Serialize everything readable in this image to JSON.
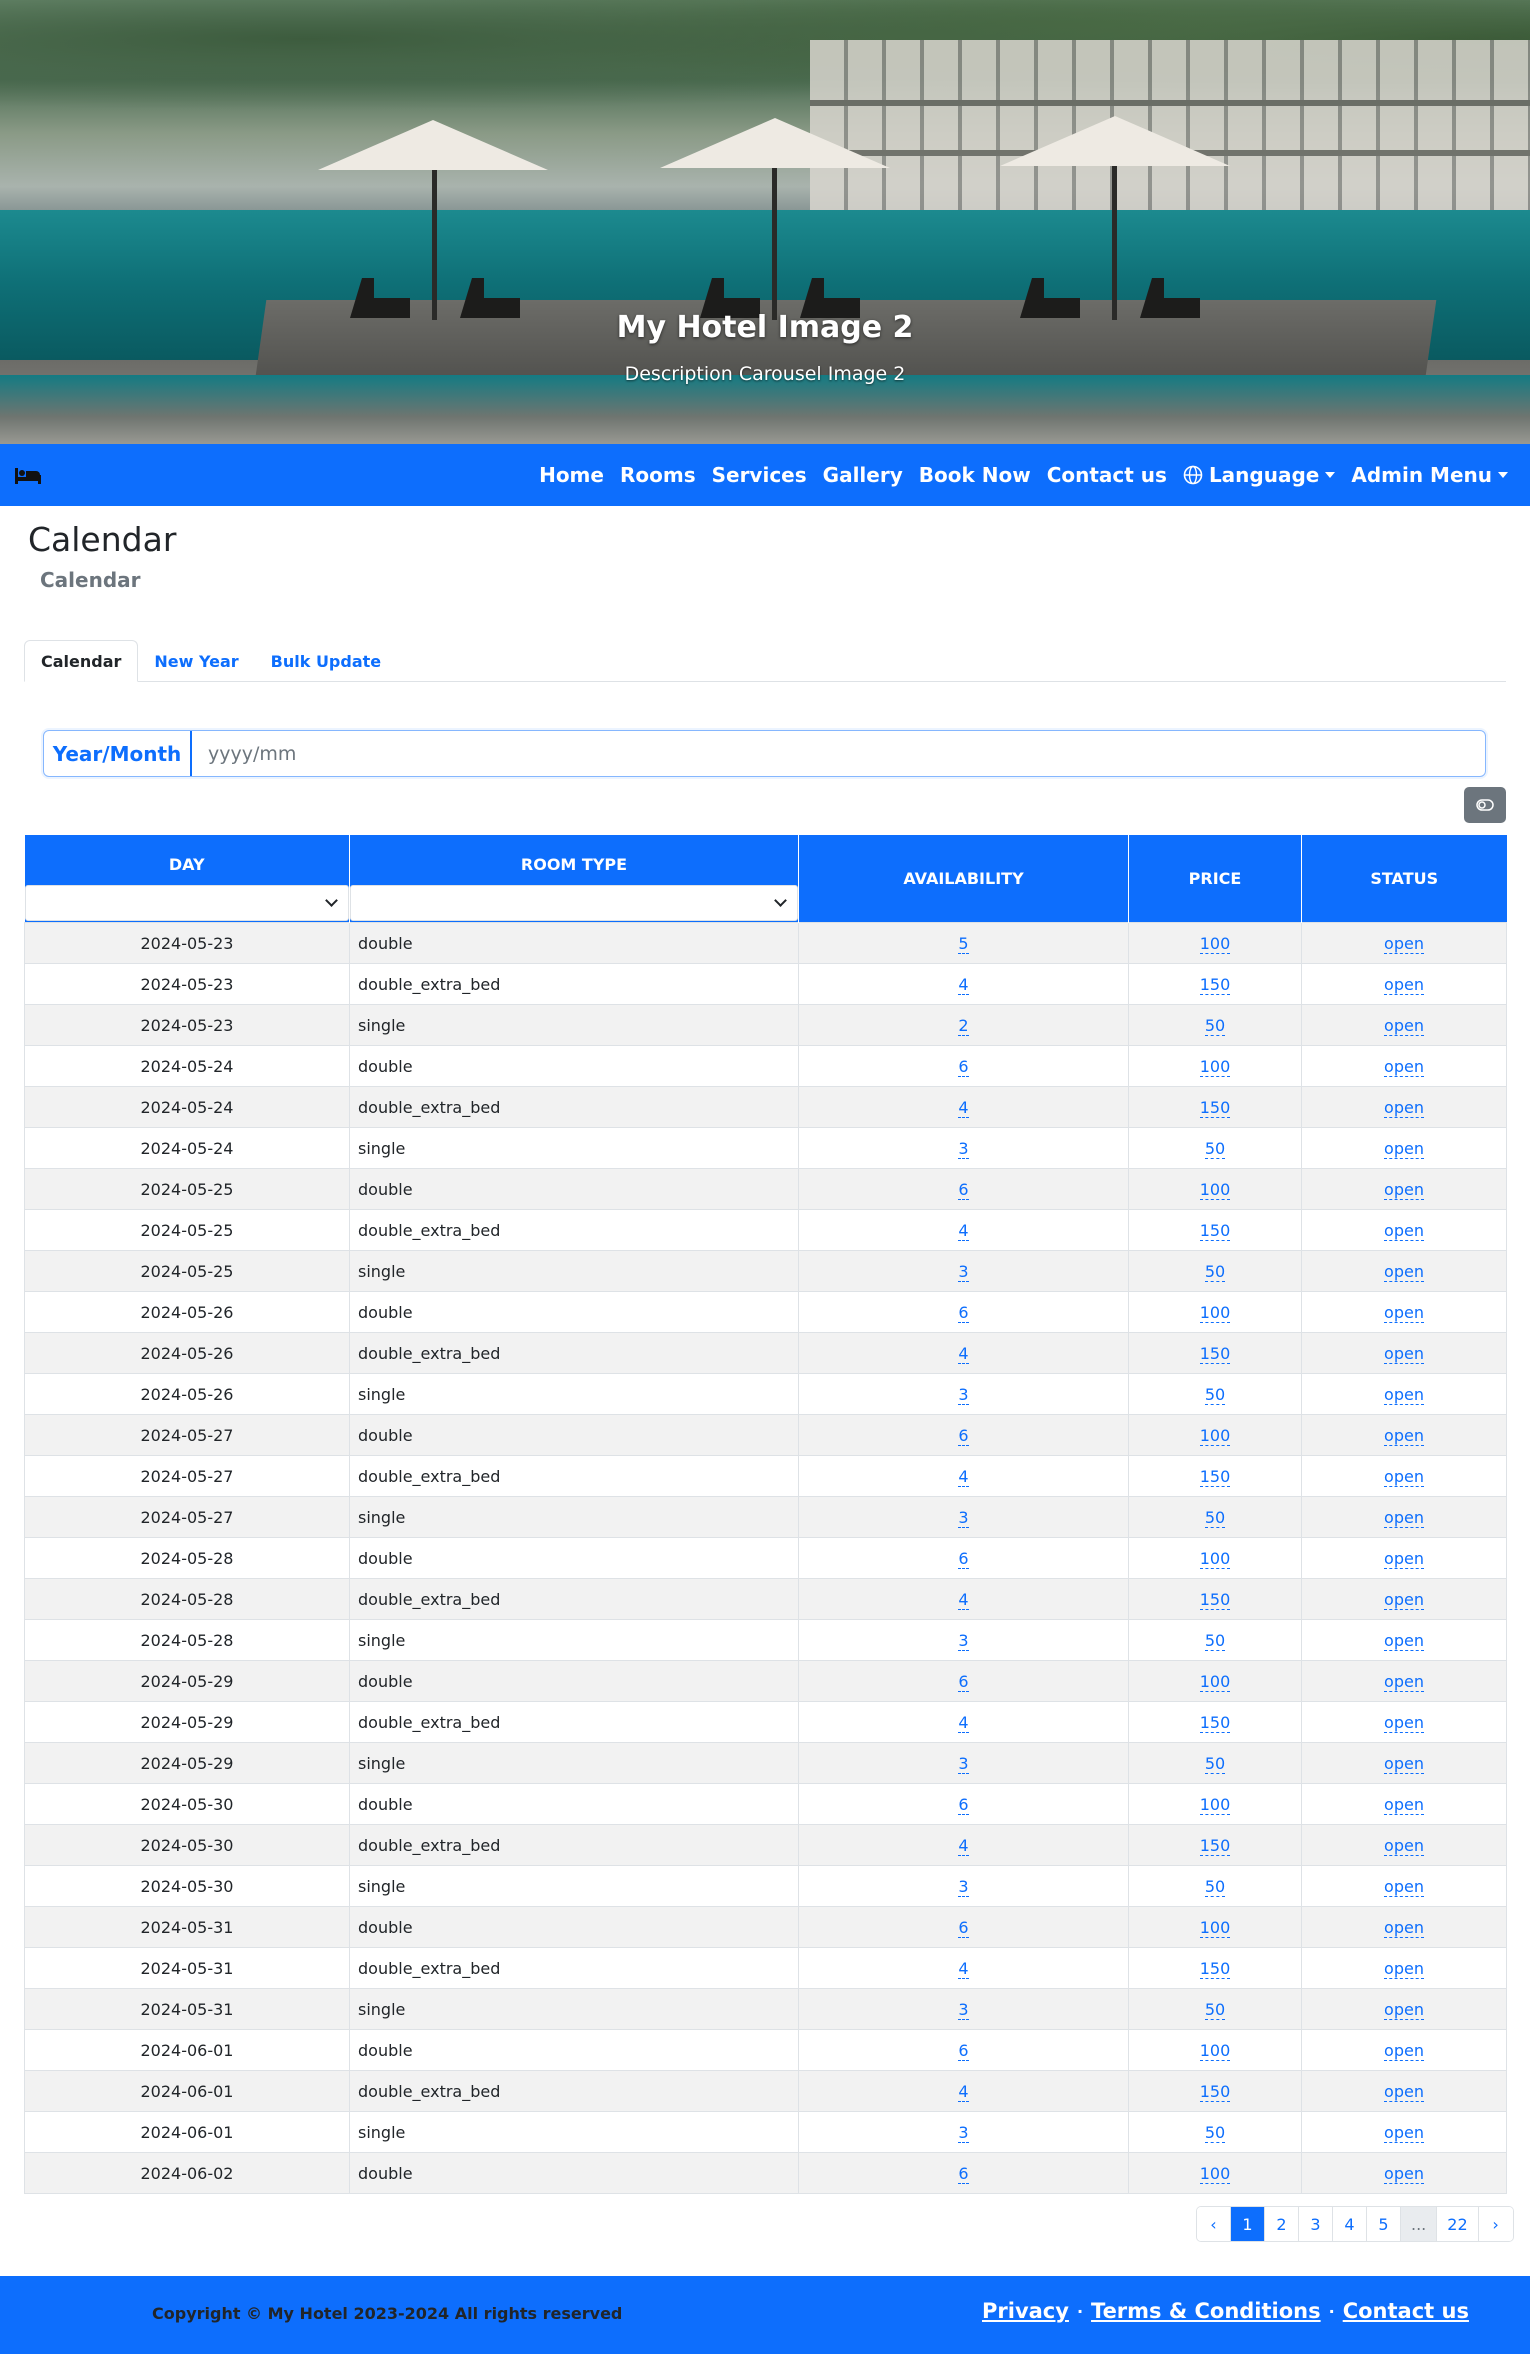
{
  "hero": {
    "title": "My Hotel Image 2",
    "description": "Description Carousel Image 2"
  },
  "navbar": {
    "brand_icon": "bed-icon",
    "links": [
      "Home",
      "Rooms",
      "Services",
      "Gallery",
      "Book Now",
      "Contact us"
    ],
    "language": "Language",
    "admin_menu": "Admin Menu",
    "color": "#0d6efd"
  },
  "page": {
    "title": "Calendar",
    "subtitle": "Calendar"
  },
  "tabs": [
    "Calendar",
    "New Year",
    "Bulk Update"
  ],
  "year_month": {
    "label": "Year/Month",
    "placeholder": "yyyy/mm",
    "value": ""
  },
  "table": {
    "columns": [
      "DAY",
      "ROOM TYPE",
      "AVAILABILITY",
      "PRICE",
      "STATUS"
    ],
    "rows": [
      [
        "2024-05-23",
        "double",
        "5",
        "100",
        "open"
      ],
      [
        "2024-05-23",
        "double_extra_bed",
        "4",
        "150",
        "open"
      ],
      [
        "2024-05-23",
        "single",
        "2",
        "50",
        "open"
      ],
      [
        "2024-05-24",
        "double",
        "6",
        "100",
        "open"
      ],
      [
        "2024-05-24",
        "double_extra_bed",
        "4",
        "150",
        "open"
      ],
      [
        "2024-05-24",
        "single",
        "3",
        "50",
        "open"
      ],
      [
        "2024-05-25",
        "double",
        "6",
        "100",
        "open"
      ],
      [
        "2024-05-25",
        "double_extra_bed",
        "4",
        "150",
        "open"
      ],
      [
        "2024-05-25",
        "single",
        "3",
        "50",
        "open"
      ],
      [
        "2024-05-26",
        "double",
        "6",
        "100",
        "open"
      ],
      [
        "2024-05-26",
        "double_extra_bed",
        "4",
        "150",
        "open"
      ],
      [
        "2024-05-26",
        "single",
        "3",
        "50",
        "open"
      ],
      [
        "2024-05-27",
        "double",
        "6",
        "100",
        "open"
      ],
      [
        "2024-05-27",
        "double_extra_bed",
        "4",
        "150",
        "open"
      ],
      [
        "2024-05-27",
        "single",
        "3",
        "50",
        "open"
      ],
      [
        "2024-05-28",
        "double",
        "6",
        "100",
        "open"
      ],
      [
        "2024-05-28",
        "double_extra_bed",
        "4",
        "150",
        "open"
      ],
      [
        "2024-05-28",
        "single",
        "3",
        "50",
        "open"
      ],
      [
        "2024-05-29",
        "double",
        "6",
        "100",
        "open"
      ],
      [
        "2024-05-29",
        "double_extra_bed",
        "4",
        "150",
        "open"
      ],
      [
        "2024-05-29",
        "single",
        "3",
        "50",
        "open"
      ],
      [
        "2024-05-30",
        "double",
        "6",
        "100",
        "open"
      ],
      [
        "2024-05-30",
        "double_extra_bed",
        "4",
        "150",
        "open"
      ],
      [
        "2024-05-30",
        "single",
        "3",
        "50",
        "open"
      ],
      [
        "2024-05-31",
        "double",
        "6",
        "100",
        "open"
      ],
      [
        "2024-05-31",
        "double_extra_bed",
        "4",
        "150",
        "open"
      ],
      [
        "2024-05-31",
        "single",
        "3",
        "50",
        "open"
      ],
      [
        "2024-06-01",
        "double",
        "6",
        "100",
        "open"
      ],
      [
        "2024-06-01",
        "double_extra_bed",
        "4",
        "150",
        "open"
      ],
      [
        "2024-06-01",
        "single",
        "3",
        "50",
        "open"
      ],
      [
        "2024-06-02",
        "double",
        "6",
        "100",
        "open"
      ]
    ]
  },
  "pagination": {
    "prev": "‹",
    "pages": [
      "1",
      "2",
      "3",
      "4",
      "5"
    ],
    "ellipsis": "...",
    "last": "22",
    "next": "›",
    "current": "1"
  },
  "footer": {
    "copyright": "Copyright © My Hotel 2023-2024 All rights reserved",
    "links": [
      "Privacy",
      "Terms & Conditions",
      "Contact us"
    ],
    "separator": "·"
  }
}
